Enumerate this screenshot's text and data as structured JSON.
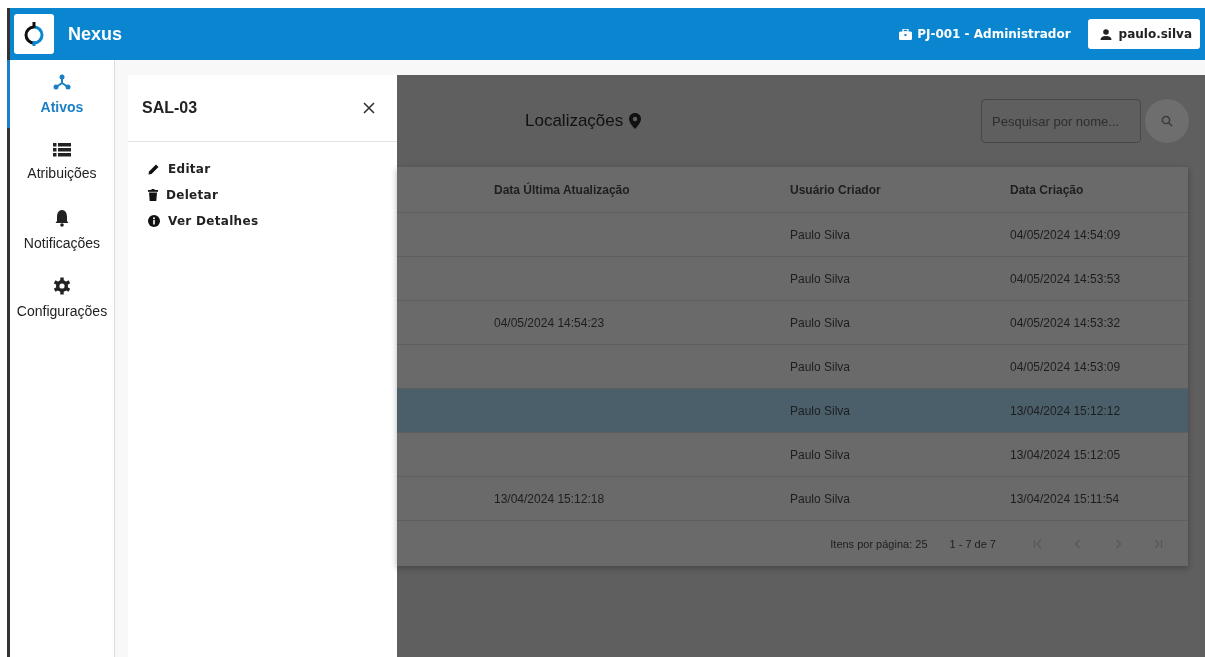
{
  "app": {
    "name": "Nexus"
  },
  "header": {
    "project": "PJ-001 - Administrador",
    "user": "paulo.silva"
  },
  "sidebar": {
    "items": [
      {
        "kind": "assets",
        "label": "Ativos",
        "selected": true
      },
      {
        "kind": "list",
        "label": "Atribuições",
        "selected": false
      },
      {
        "kind": "bell",
        "label": "Notificações",
        "selected": false
      },
      {
        "kind": "gear",
        "label": "Configurações",
        "selected": false
      }
    ]
  },
  "drawer": {
    "title": "SAL-03",
    "actions": [
      {
        "kind": "edit",
        "label": "Editar"
      },
      {
        "kind": "delete",
        "label": "Deletar"
      },
      {
        "kind": "info",
        "label": "Ver Detalhes"
      }
    ]
  },
  "page": {
    "title": "Localizações",
    "search": {
      "placeholder": "Pesquisar por nome..."
    }
  },
  "table": {
    "columns": [
      "Data Última Atualização",
      "Usuário Criador",
      "Data Criação"
    ],
    "rows": [
      {
        "cells": [
          null,
          "Paulo Silva",
          "04/05/2024 14:54:09"
        ],
        "selected": false
      },
      {
        "cells": [
          null,
          "Paulo Silva",
          "04/05/2024 14:53:53"
        ],
        "selected": false
      },
      {
        "cells": [
          "04/05/2024 14:54:23",
          "Paulo Silva",
          "04/05/2024 14:53:32"
        ],
        "selected": false
      },
      {
        "cells": [
          null,
          "Paulo Silva",
          "04/05/2024 14:53:09"
        ],
        "selected": false
      },
      {
        "cells": [
          null,
          "Paulo Silva",
          "13/04/2024 15:12:12"
        ],
        "selected": true
      },
      {
        "cells": [
          null,
          "Paulo Silva",
          "13/04/2024 15:12:05"
        ],
        "selected": false
      },
      {
        "cells": [
          "13/04/2024 15:12:18",
          "Paulo Silva",
          "13/04/2024 15:11:54"
        ],
        "selected": false
      }
    ]
  },
  "pagination": {
    "page_size": "Itens por página: 25",
    "range": "1 - 7 de 7",
    "buttons": [
      {
        "kind": "first",
        "disabled": true
      },
      {
        "kind": "prev",
        "disabled": true
      },
      {
        "kind": "next",
        "disabled": true
      },
      {
        "kind": "last",
        "disabled": true
      }
    ]
  }
}
